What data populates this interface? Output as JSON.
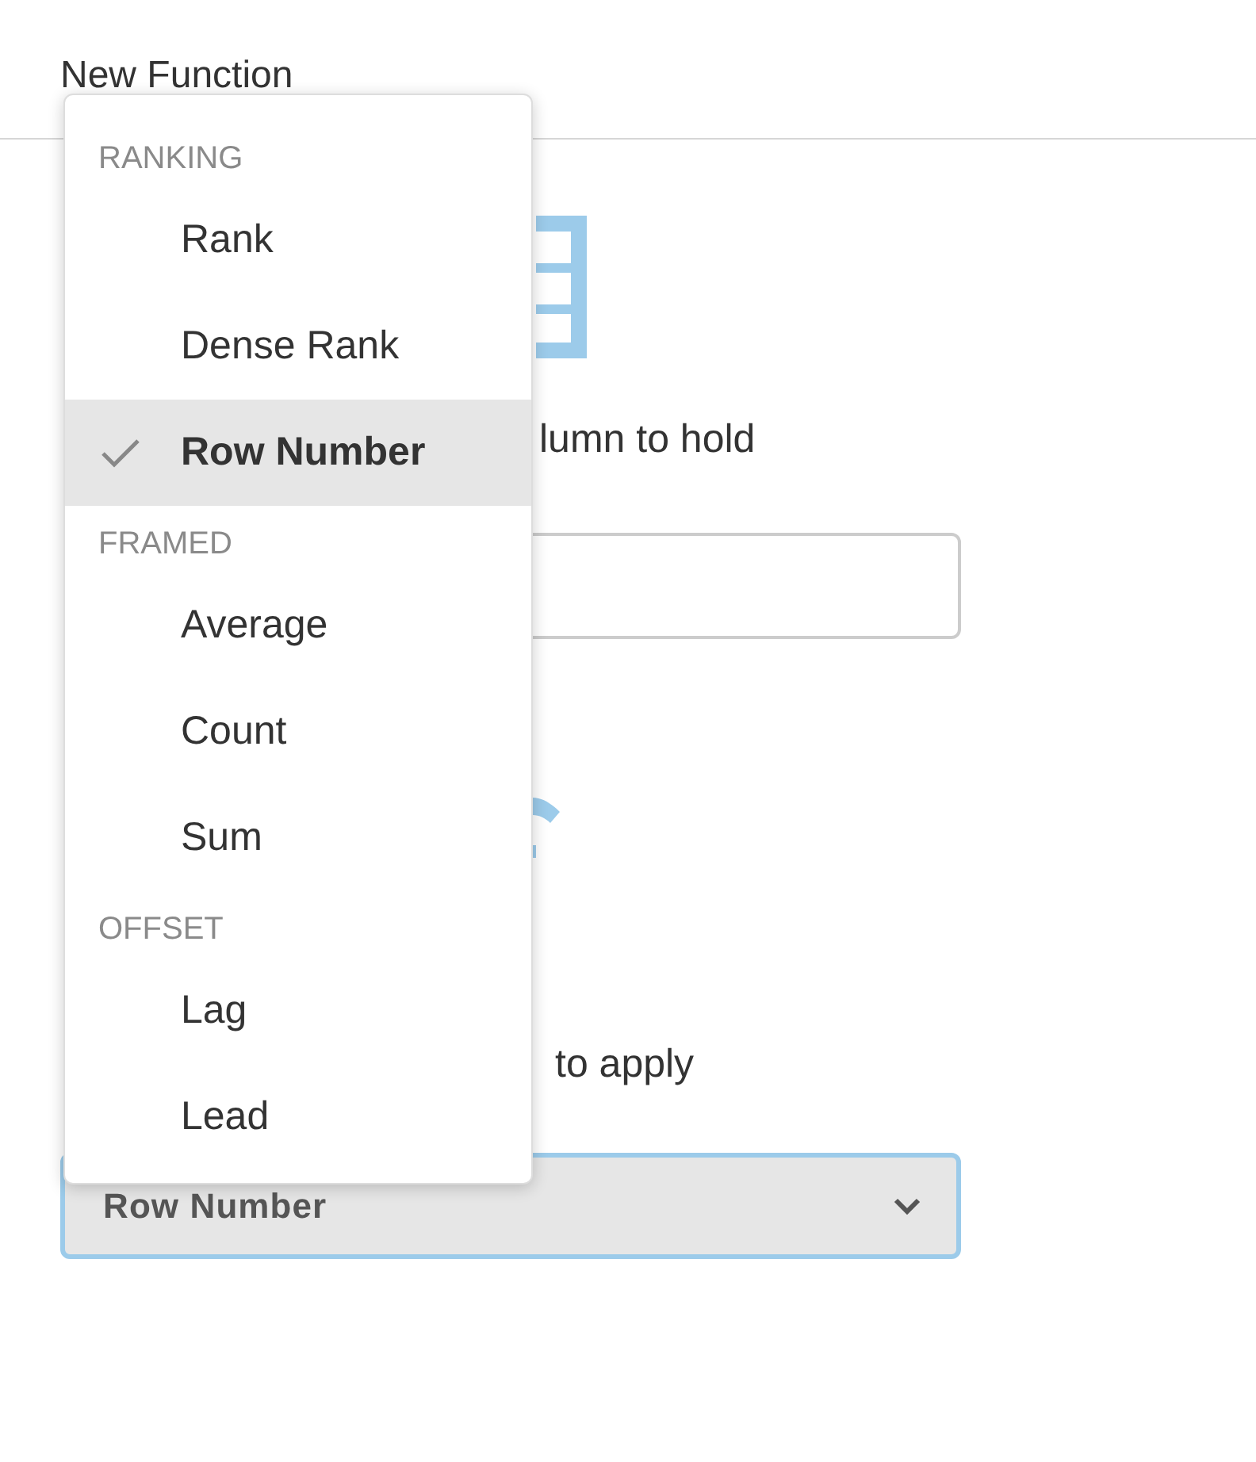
{
  "title": "New Function",
  "name_prompt": "lumn to hold",
  "function_prompt": "to apply",
  "function_select": {
    "value": "Row Number",
    "focused": true
  },
  "menu": {
    "groups": [
      {
        "heading": "RANKING",
        "items": [
          {
            "label": "Rank",
            "selected": false
          },
          {
            "label": "Dense Rank",
            "selected": false
          },
          {
            "label": "Row Number",
            "selected": true
          }
        ]
      },
      {
        "heading": "FRAMED",
        "items": [
          {
            "label": "Average",
            "selected": false
          },
          {
            "label": "Count",
            "selected": false
          },
          {
            "label": "Sum",
            "selected": false
          }
        ]
      },
      {
        "heading": "OFFSET",
        "items": [
          {
            "label": "Lag",
            "selected": false
          },
          {
            "label": "Lead",
            "selected": false
          }
        ]
      }
    ]
  }
}
